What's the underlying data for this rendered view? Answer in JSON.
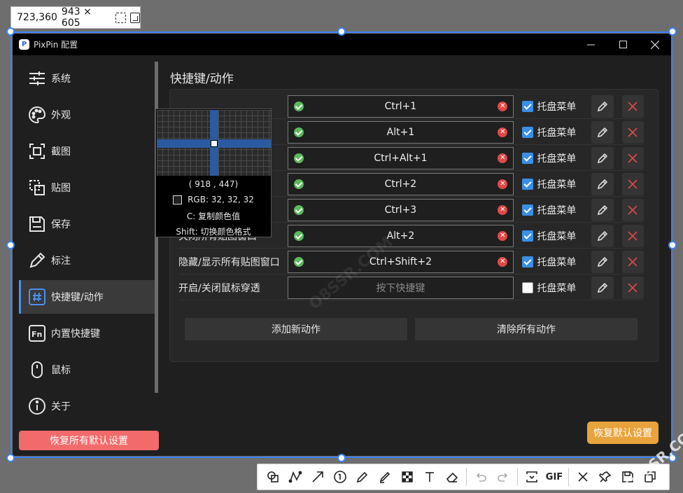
{
  "capture": {
    "position": "723,360",
    "size": "943 × 605"
  },
  "window": {
    "title": "PixPin 配置",
    "logo_letter": "P"
  },
  "sidebar": {
    "items": [
      {
        "label": "系统",
        "icon": "sliders-icon"
      },
      {
        "label": "外观",
        "icon": "palette-icon"
      },
      {
        "label": "截图",
        "icon": "screenshot-icon"
      },
      {
        "label": "贴图",
        "icon": "pin-image-icon"
      },
      {
        "label": "保存",
        "icon": "save-icon"
      },
      {
        "label": "标注",
        "icon": "pencil-icon"
      },
      {
        "label": "快捷键/动作",
        "icon": "hash-icon",
        "active": true
      },
      {
        "label": "内置快捷键",
        "icon": "fn-key-icon"
      },
      {
        "label": "鼠标",
        "icon": "mouse-icon"
      },
      {
        "label": "关于",
        "icon": "info-icon"
      }
    ],
    "reset_all_label": "恢复所有默认设置"
  },
  "main": {
    "title": "快捷键/动作",
    "rows": [
      {
        "name": "",
        "hotkey": "Ctrl+1",
        "tray_label": "托盘菜单",
        "tray_checked": true
      },
      {
        "name": "",
        "hotkey": "Alt+1",
        "tray_label": "托盘菜单",
        "tray_checked": true
      },
      {
        "name": "",
        "hotkey": "Ctrl+Alt+1",
        "tray_label": "托盘菜单",
        "tray_checked": true
      },
      {
        "name": "",
        "hotkey": "Ctrl+2",
        "tray_label": "托盘菜单",
        "tray_checked": true
      },
      {
        "name": "",
        "hotkey": "Ctrl+3",
        "tray_label": "托盘菜单",
        "tray_checked": true
      },
      {
        "name": "关闭所有贴图窗口",
        "hotkey": "Alt+2",
        "tray_label": "托盘菜单",
        "tray_checked": true
      },
      {
        "name": "隐藏/显示所有贴图窗口",
        "hotkey": "Ctrl+Shift+2",
        "tray_label": "托盘菜单",
        "tray_checked": true
      },
      {
        "name": "开启/关闭鼠标穿透",
        "hotkey": "",
        "placeholder": "按下快捷键",
        "tray_label": "托盘菜单",
        "tray_checked": false
      }
    ],
    "add_action_label": "添加新动作",
    "clear_actions_label": "清除所有动作",
    "reset_default_label": "恢复默认设置"
  },
  "magnifier": {
    "coords": "( 918 ,  447)",
    "rgb": "RGB:  32, 32, 32",
    "copy_hint": "C: 复制颜色值",
    "switch_hint": "Shift: 切换颜色格式"
  },
  "toolbar": {
    "tools": [
      "shape-icon",
      "polyline-icon",
      "arrow-icon",
      "number-icon",
      "pen-icon",
      "marker-icon",
      "mosaic-icon",
      "text-icon",
      "eraser-icon",
      "undo-icon",
      "redo-icon",
      "long-screenshot-icon",
      "gif-icon",
      "close-icon",
      "pin-icon",
      "save-icon",
      "copy-icon"
    ],
    "gif_label": "GIF"
  },
  "watermark": "O8SSR.COM",
  "colors": {
    "accent": "#3b82f6",
    "reset_all": "#f26a6a",
    "reset_default": "#e8a33c",
    "ok": "#5cb85c",
    "clear": "#e04848",
    "checkbox": "#3a8ee6"
  }
}
